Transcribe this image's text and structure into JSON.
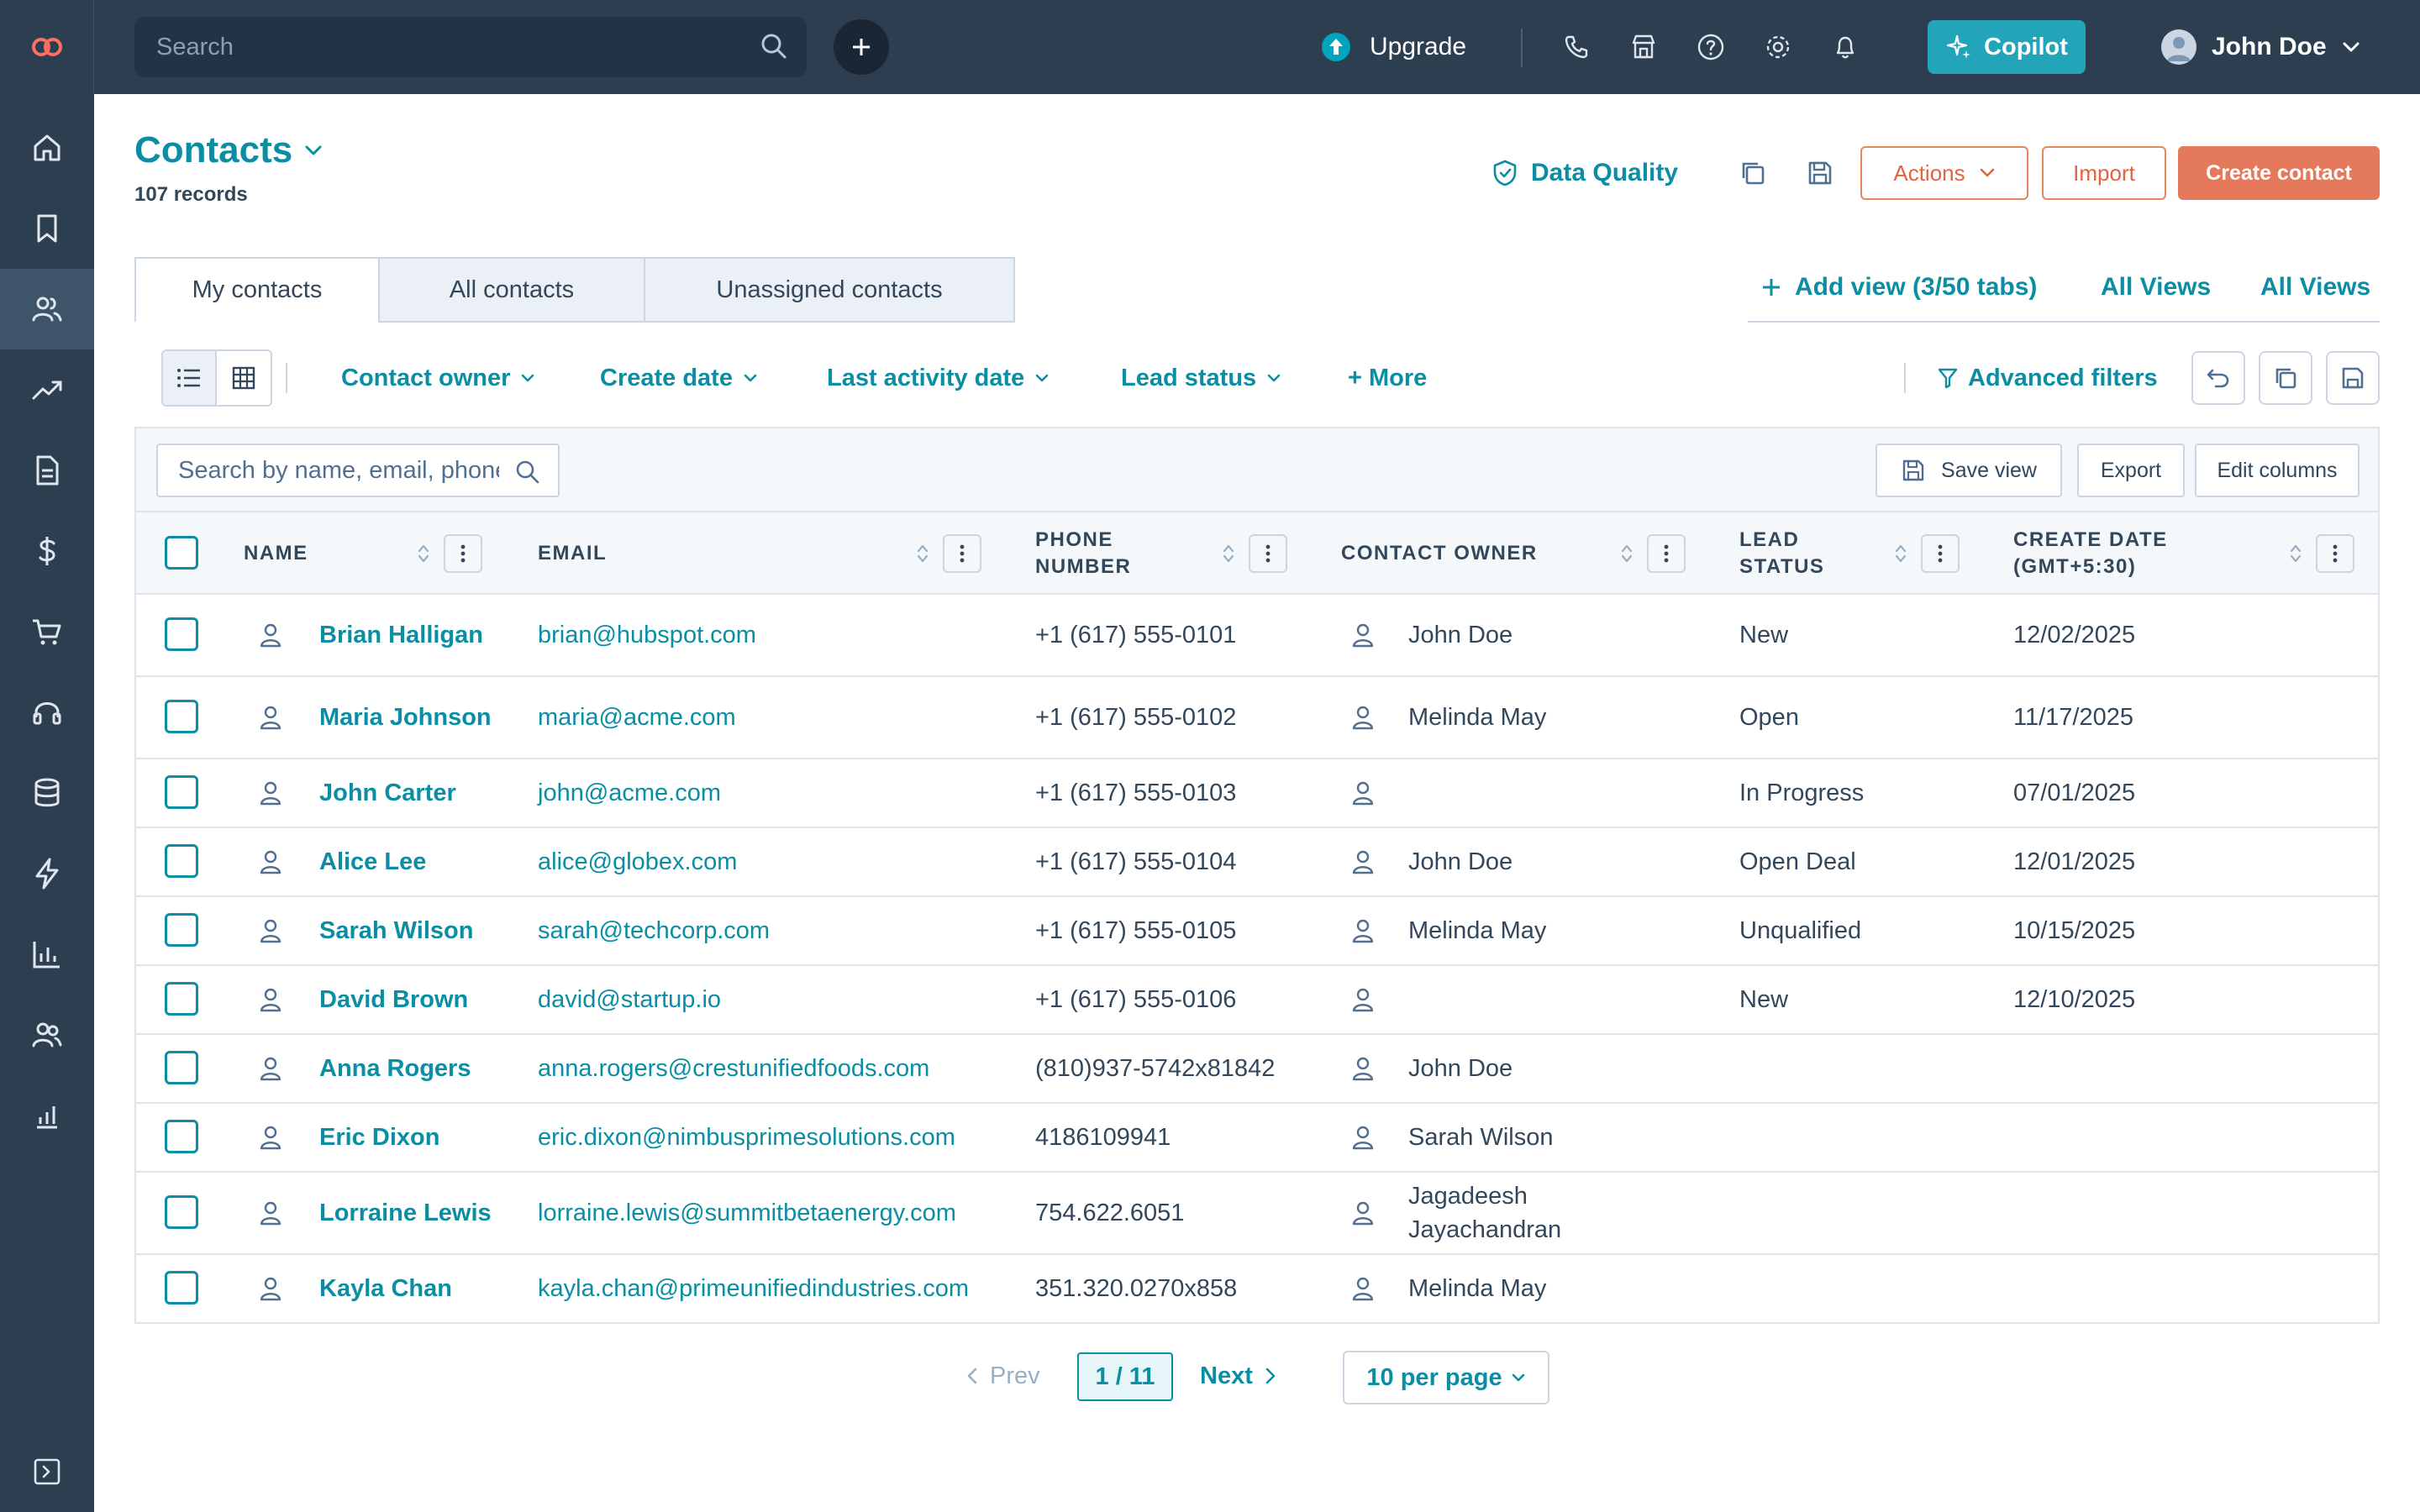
{
  "colors": {
    "nav_bg": "#2d3e50",
    "accent": "#0b8ea3",
    "primary_button": "#e5795b",
    "copilot": "#22a5b8"
  },
  "topbar": {
    "search_placeholder": "Search",
    "upgrade_label": "Upgrade",
    "copilot_label": "Copilot",
    "user_name": "John Doe",
    "icons": [
      "phone-icon",
      "marketplace-icon",
      "help-icon",
      "settings-icon",
      "notifications-icon"
    ]
  },
  "sidebar": {
    "items": [
      "home-icon",
      "bookmark-icon",
      "contacts-icon",
      "marketing-icon",
      "content-icon",
      "sales-icon",
      "commerce-icon",
      "service-icon",
      "data-icon",
      "automation-icon",
      "reporting-icon",
      "users-icon",
      "analytics-icon"
    ],
    "expand_icon": "expand-sidebar-icon"
  },
  "header": {
    "title": "Contacts",
    "record_count": "107 records",
    "data_quality_label": "Data Quality",
    "actions_label": "Actions",
    "import_label": "Import",
    "create_label": "Create contact"
  },
  "tabs": [
    "My contacts",
    "All contacts",
    "Unassigned contacts"
  ],
  "views": {
    "add_view_label": "Add view (3/50 tabs)",
    "all_views_1": "All Views",
    "all_views_2": "All Views"
  },
  "filters": {
    "items": [
      "Contact owner",
      "Create date",
      "Last activity date",
      "Lead status"
    ],
    "more_label": "+ More",
    "advanced_label": "Advanced filters"
  },
  "table": {
    "search_placeholder": "Search by name, email, phone",
    "save_view_label": "Save view",
    "export_label": "Export",
    "edit_columns_label": "Edit columns",
    "columns": [
      "NAME",
      "EMAIL",
      "PHONE NUMBER",
      "CONTACT OWNER",
      "LEAD STATUS",
      "CREATE DATE (GMT+5:30)"
    ],
    "rows": [
      {
        "name": "Brian Halligan",
        "email": "brian@hubspot.com",
        "phone": "+1 (617) 555-0101",
        "owner": "John Doe",
        "status": "New",
        "created": "12/02/2025"
      },
      {
        "name": "Maria Johnson",
        "email": "maria@acme.com",
        "phone": "+1 (617) 555-0102",
        "owner": "Melinda May",
        "status": "Open",
        "created": "11/17/2025"
      },
      {
        "name": "John Carter",
        "email": "john@acme.com",
        "phone": "+1 (617) 555-0103",
        "owner": "",
        "status": "In Progress",
        "created": "07/01/2025"
      },
      {
        "name": "Alice Lee",
        "email": "alice@globex.com",
        "phone": "+1 (617) 555-0104",
        "owner": "John Doe",
        "status": "Open Deal",
        "created": "12/01/2025"
      },
      {
        "name": "Sarah Wilson",
        "email": "sarah@techcorp.com",
        "phone": "+1 (617) 555-0105",
        "owner": "Melinda May",
        "status": "Unqualified",
        "created": "10/15/2025"
      },
      {
        "name": "David Brown",
        "email": "david@startup.io",
        "phone": "+1 (617) 555-0106",
        "owner": "",
        "status": "New",
        "created": "12/10/2025"
      },
      {
        "name": "Anna Rogers",
        "email": "anna.rogers@crestunifiedfoods.com",
        "phone": "(810)937-5742x81842",
        "owner": "John Doe",
        "status": "",
        "created": ""
      },
      {
        "name": "Eric Dixon",
        "email": "eric.dixon@nimbusprimesolutions.com",
        "phone": "4186109941",
        "owner": "Sarah Wilson",
        "status": "",
        "created": ""
      },
      {
        "name": "Lorraine Lewis",
        "email": "lorraine.lewis@summitbetaenergy.com",
        "phone": "754.622.6051",
        "owner": "Jagadeesh Jayachandran",
        "status": "",
        "created": ""
      },
      {
        "name": "Kayla Chan",
        "email": "kayla.chan@primeunifiedindustries.com",
        "phone": "351.320.0270x858",
        "owner": "Melinda May",
        "status": "",
        "created": ""
      }
    ]
  },
  "pagination": {
    "prev_label": "Prev",
    "page_label": "1 / 11",
    "next_label": "Next",
    "per_page_label": "10 per page"
  }
}
